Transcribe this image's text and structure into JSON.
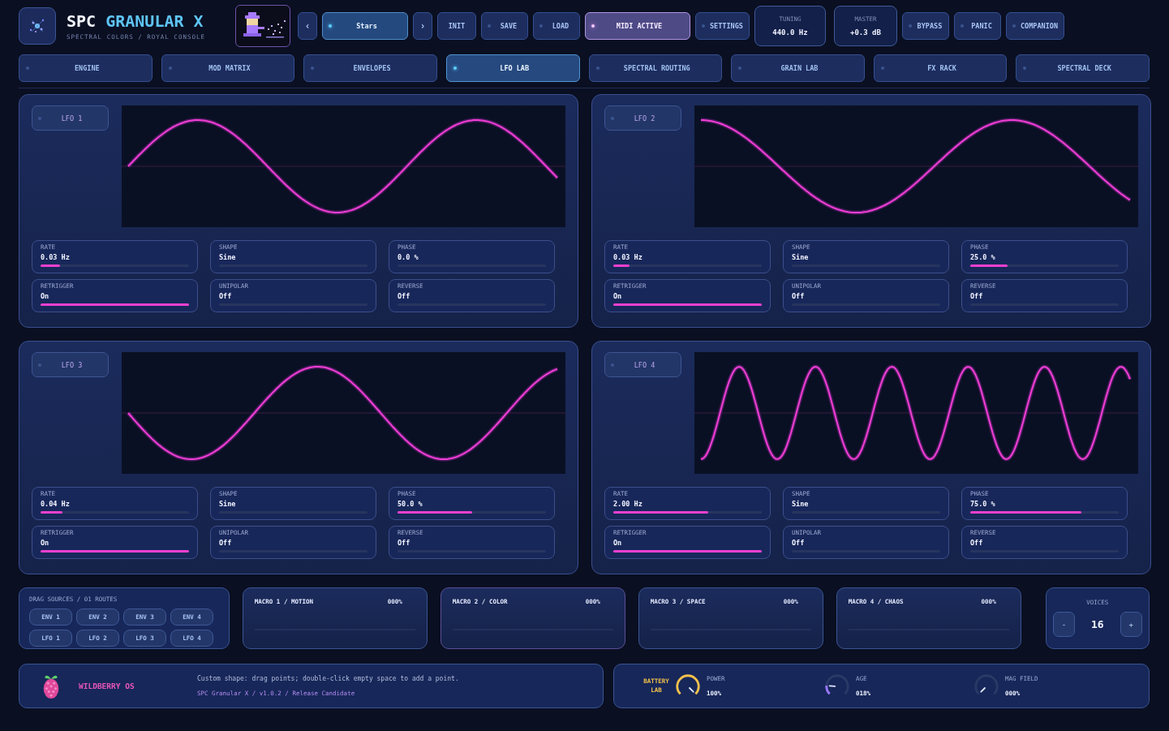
{
  "header": {
    "title_main": "SPC",
    "title_accent": "GRANULAR X",
    "subtitle": "SPECTRAL COLORS / ROYAL CONSOLE"
  },
  "toolbar": [
    {
      "kind": "nav",
      "label": "‹"
    },
    {
      "kind": "preset",
      "label": "Stars",
      "active": true
    },
    {
      "kind": "nav",
      "label": "›"
    },
    {
      "kind": "plain",
      "label": "INIT"
    },
    {
      "kind": "button",
      "label": "SAVE",
      "active": false
    },
    {
      "kind": "button",
      "label": "LOAD",
      "active": false
    },
    {
      "kind": "midi",
      "label": "MIDI ACTIVE",
      "active": true
    },
    {
      "kind": "button",
      "label": "SETTINGS",
      "active": false
    },
    {
      "kind": "readout",
      "label": "TUNING",
      "value": "440.0 Hz"
    },
    {
      "kind": "readout",
      "label": "MASTER",
      "value": "+0.3 dB"
    },
    {
      "kind": "button",
      "label": "BYPASS",
      "active": false
    },
    {
      "kind": "button",
      "label": "PANIC",
      "active": false
    },
    {
      "kind": "button",
      "label": "COMPANION",
      "active": false
    }
  ],
  "tabs": [
    {
      "label": "ENGINE",
      "selected": false
    },
    {
      "label": "MOD MATRIX",
      "selected": false
    },
    {
      "label": "ENVELOPES",
      "selected": false
    },
    {
      "label": "LFO LAB",
      "selected": true
    },
    {
      "label": "SPECTRAL ROUTING",
      "selected": false
    },
    {
      "label": "GRAIN LAB",
      "selected": false
    },
    {
      "label": "FX RACK",
      "selected": false
    },
    {
      "label": "SPECTRAL DECK",
      "selected": false
    }
  ],
  "lfos": [
    {
      "title": "LFO 1",
      "params": [
        {
          "label": "RATE",
          "value": "0.03 Hz",
          "level": 0.13
        },
        {
          "label": "SHAPE",
          "value": "Sine"
        },
        {
          "label": "PHASE",
          "value": "0.0 %"
        },
        {
          "label": "RETRIGGER",
          "value": "On",
          "level": 1
        },
        {
          "label": "UNIPOLAR",
          "value": "Off"
        },
        {
          "label": "REVERSE",
          "value": "Off"
        }
      ]
    },
    {
      "title": "LFO 2",
      "params": [
        {
          "label": "RATE",
          "value": "0.03 Hz",
          "level": 0.11
        },
        {
          "label": "SHAPE",
          "value": "Sine"
        },
        {
          "label": "PHASE",
          "value": "25.0 %",
          "level": 0.25
        },
        {
          "label": "RETRIGGER",
          "value": "On",
          "level": 1
        },
        {
          "label": "UNIPOLAR",
          "value": "Off"
        },
        {
          "label": "REVERSE",
          "value": "Off"
        }
      ]
    },
    {
      "title": "LFO 3",
      "params": [
        {
          "label": "RATE",
          "value": "0.04 Hz",
          "level": 0.15
        },
        {
          "label": "SHAPE",
          "value": "Sine"
        },
        {
          "label": "PHASE",
          "value": "50.0 %",
          "level": 0.5
        },
        {
          "label": "RETRIGGER",
          "value": "On",
          "level": 1
        },
        {
          "label": "UNIPOLAR",
          "value": "Off"
        },
        {
          "label": "REVERSE",
          "value": "Off"
        }
      ]
    },
    {
      "title": "LFO 4",
      "params": [
        {
          "label": "RATE",
          "value": "2.00 Hz",
          "level": 0.64
        },
        {
          "label": "SHAPE",
          "value": "Sine"
        },
        {
          "label": "PHASE",
          "value": "75.0 %",
          "level": 0.75
        },
        {
          "label": "RETRIGGER",
          "value": "On",
          "level": 1
        },
        {
          "label": "UNIPOLAR",
          "value": "Off"
        },
        {
          "label": "REVERSE",
          "value": "Off"
        }
      ]
    }
  ],
  "drag_sources": {
    "title": "DRAG SOURCES / 01 ROUTES",
    "chips": [
      "ENV 1",
      "ENV 2",
      "ENV 3",
      "ENV 4",
      "LFO 1",
      "LFO 2",
      "LFO 3",
      "LFO 4"
    ]
  },
  "macros": [
    {
      "title": "MACRO 1 / MOTION",
      "value": "000%"
    },
    {
      "title": "MACRO 2 / COLOR",
      "value": "000%"
    },
    {
      "title": "MACRO 3 / SPACE",
      "value": "000%"
    },
    {
      "title": "MACRO 4 / CHAOS",
      "value": "000%"
    }
  ],
  "voices": {
    "label": "VOICES",
    "value": "16",
    "minus": "-",
    "plus": "+"
  },
  "status": {
    "brand": "WILDBERRY OS",
    "hint": "Custom shape: drag points; double-click empty space to add a point.",
    "version": "SPC Granular X / v1.0.2 / Release Candidate"
  },
  "battery_lab": {
    "title": "BATTERY LAB",
    "knobs": [
      {
        "label": "POWER",
        "value": "100%",
        "level": 1,
        "color": "#f4c14c"
      },
      {
        "label": "AGE",
        "value": "018%",
        "level": 0.18,
        "color": "#9a78ff"
      },
      {
        "label": "MAG FIELD",
        "value": "000%"
      }
    ]
  }
}
